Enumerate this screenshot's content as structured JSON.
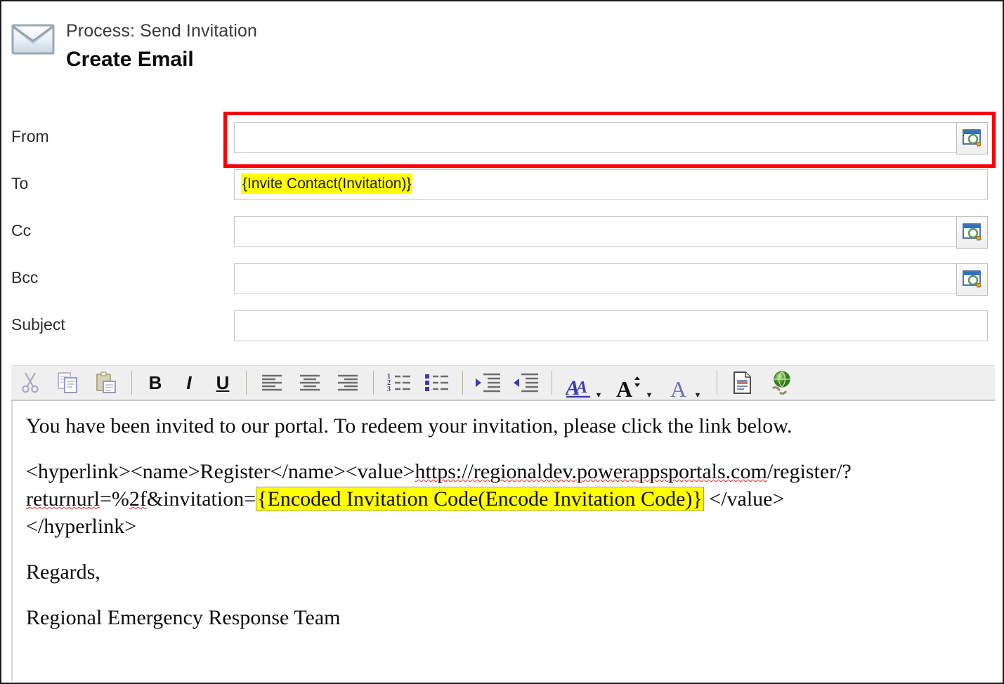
{
  "header": {
    "icon": "envelope-icon",
    "process_label": "Process: Send Invitation",
    "title": "Create Email"
  },
  "form": {
    "rows": [
      {
        "label": "From",
        "value": "",
        "highlighted": false,
        "lookup": true,
        "annotated": true
      },
      {
        "label": "To",
        "value": "{Invite Contact(Invitation)}",
        "highlighted": true,
        "lookup": false,
        "annotated": false
      },
      {
        "label": "Cc",
        "value": "",
        "highlighted": false,
        "lookup": true,
        "annotated": false
      },
      {
        "label": "Bcc",
        "value": "",
        "highlighted": false,
        "lookup": true,
        "annotated": false
      },
      {
        "label": "Subject",
        "value": "",
        "highlighted": false,
        "lookup": false,
        "annotated": false
      }
    ],
    "annotation_color": "#ff0000",
    "highlight_color": "#ffff00"
  },
  "toolbar": {
    "items": [
      {
        "name": "cut-icon",
        "label": "Cut"
      },
      {
        "name": "copy-icon",
        "label": "Copy"
      },
      {
        "name": "paste-icon",
        "label": "Paste"
      },
      {
        "name": "separator",
        "label": ""
      },
      {
        "name": "bold-icon",
        "label": "B"
      },
      {
        "name": "italic-icon",
        "label": "I"
      },
      {
        "name": "underline-icon",
        "label": "U"
      },
      {
        "name": "separator",
        "label": ""
      },
      {
        "name": "align-left-icon",
        "label": "Align Left"
      },
      {
        "name": "align-center-icon",
        "label": "Align Center"
      },
      {
        "name": "align-right-icon",
        "label": "Align Right"
      },
      {
        "name": "separator",
        "label": ""
      },
      {
        "name": "numbered-list-icon",
        "label": "Numbered List"
      },
      {
        "name": "bulleted-list-icon",
        "label": "Bulleted List"
      },
      {
        "name": "separator",
        "label": ""
      },
      {
        "name": "increase-indent-icon",
        "label": "Increase Indent"
      },
      {
        "name": "decrease-indent-icon",
        "label": "Decrease Indent"
      },
      {
        "name": "separator",
        "label": ""
      },
      {
        "name": "font-family-icon",
        "label": "A"
      },
      {
        "name": "font-size-icon",
        "label": "A"
      },
      {
        "name": "font-color-icon",
        "label": "A"
      },
      {
        "name": "separator",
        "label": ""
      },
      {
        "name": "source-view-icon",
        "label": "Source"
      },
      {
        "name": "insert-link-icon",
        "label": "Insert Link"
      }
    ]
  },
  "body": {
    "line1": "You have been invited to our portal. To redeem your invitation, please click the link below.",
    "hyperlink_open": "<hyperlink><name>Register</name><value>",
    "url_part1": "https://regionaldev.powerappsportals.com",
    "url_part2": "/register/?",
    "url_part3": "returnurl",
    "url_part4": "=%",
    "url_part5": "2f",
    "url_part6": "&invitation=",
    "token": "{Encoded Invitation Code(Encode Invitation Code)}",
    "value_close": "</value>",
    "hyperlink_close": "</hyperlink>",
    "signoff": "Regards,",
    "team": "Regional Emergency Response Team"
  }
}
